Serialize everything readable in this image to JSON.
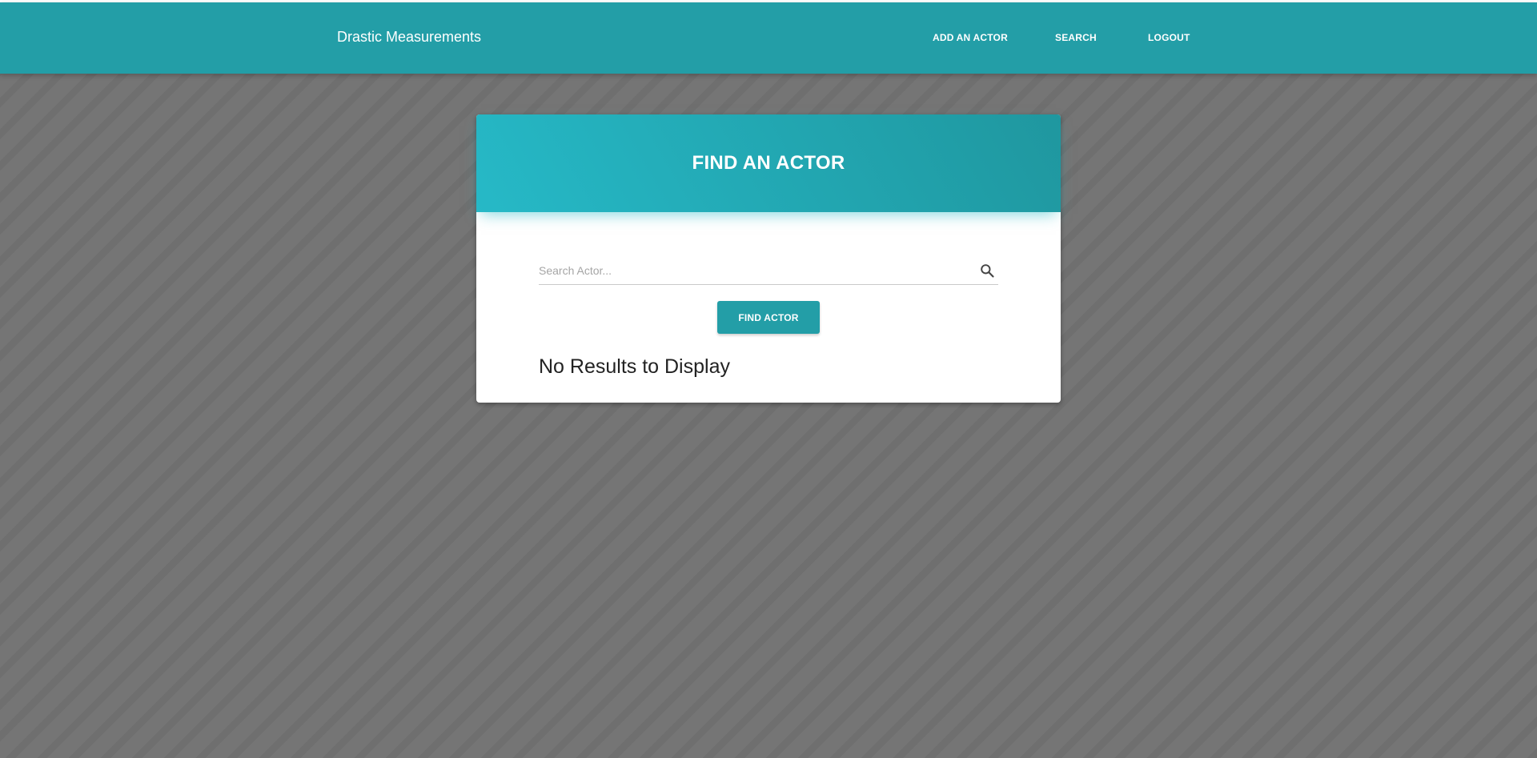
{
  "navbar": {
    "brand": "Drastic Measurements",
    "links": [
      {
        "label": "ADD AN ACTOR"
      },
      {
        "label": "SEARCH"
      },
      {
        "label": "LOGOUT"
      }
    ],
    "color": "#239ea7"
  },
  "card": {
    "title": "FIND AN ACTOR",
    "search": {
      "placeholder": "Search Actor...",
      "value": "",
      "icon": "search-icon"
    },
    "button_label": "FIND ACTOR",
    "results_message": "No Results to Display"
  },
  "colors": {
    "accent": "#239ea7",
    "header_gradient_start": "#26b9c7",
    "header_gradient_end": "#1f979f",
    "background": "#757575"
  }
}
